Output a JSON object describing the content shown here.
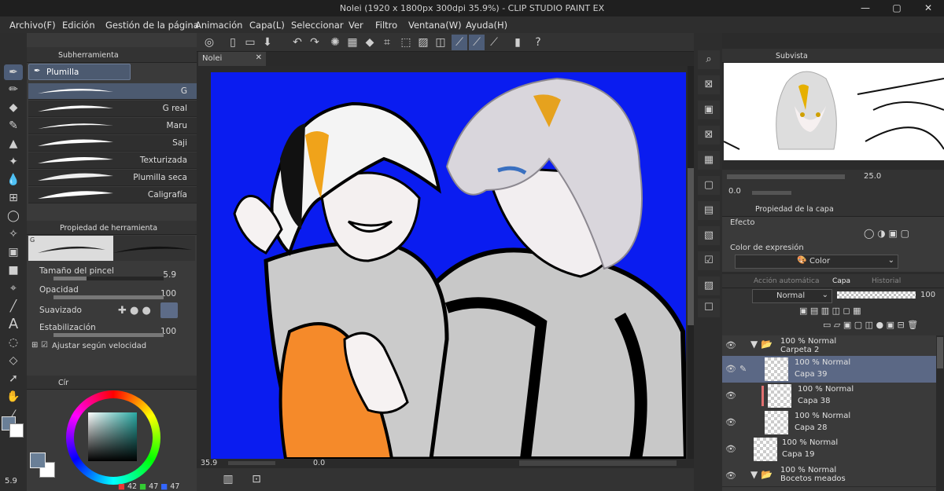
{
  "window": {
    "title": "Nolei (1920 x 1800px 300dpi 35.9%)  - CLIP STUDIO PAINT EX",
    "minimize": "—",
    "maximize": "▢",
    "close": "✕"
  },
  "menu": [
    "Archivo(F)",
    "Edición",
    "Gestión de la página",
    "Animación",
    "Capa(L)",
    "Seleccionar",
    "Ver",
    "Filtro",
    "Ventana(W)",
    "Ayuda(H)"
  ],
  "subtool": {
    "header": "Subherramienta",
    "group": "Plumilla",
    "items": [
      "G",
      "G real",
      "Maru",
      "Saji",
      "Texturizada",
      "Plumilla seca",
      "Caligrafía"
    ]
  },
  "tool_property": {
    "header": "Propiedad de herramienta",
    "preview_label": "G",
    "brush_size_label": "Tamaño del pincel",
    "brush_size": "5.9",
    "opacity_label": "Opacidad",
    "opacity": "100",
    "smoothing_label": "Suavizado",
    "stabilization_label": "Estabilización",
    "stabilization": "100",
    "speed_label": "Ajustar según velocidad"
  },
  "color": {
    "tab": "Cír",
    "main_color": "#6a7f97",
    "sub_color": "#ffffff",
    "r": "42",
    "g": "47",
    "b": "47",
    "brush_size_readout": "5.9"
  },
  "canvas": {
    "tab": "Nolei",
    "background": "#0a1cf0",
    "zoom": "35.9",
    "rotation": "0.0"
  },
  "navigator": {
    "tab": "Subvista",
    "zoom": "25.0",
    "rotation": "0.0"
  },
  "layer_property": {
    "header": "Propiedad de la capa",
    "effect_label": "Efecto",
    "expression_label": "Color de expresión",
    "expression_value": "Color"
  },
  "layer_panel": {
    "tabs": [
      "Acción automática",
      "Capa",
      "Historial"
    ],
    "blend_mode": "Normal",
    "opacity": "100",
    "layers": [
      {
        "mode": "100 % Normal",
        "name": "Carpeta 2",
        "folder": true
      },
      {
        "mode": "100 % Normal",
        "name": "Capa 39",
        "selected": true
      },
      {
        "mode": "100 % Normal",
        "name": "Capa 38"
      },
      {
        "mode": "100 % Normal",
        "name": "Capa 28"
      },
      {
        "mode": "100 % Normal",
        "name": "Capa 19"
      },
      {
        "mode": "100 % Normal",
        "name": "Bocetos meados",
        "folder": true
      }
    ]
  }
}
